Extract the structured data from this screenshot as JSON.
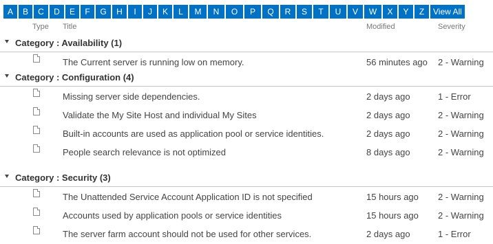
{
  "alphabet": [
    "A",
    "B",
    "C",
    "D",
    "E",
    "F",
    "G",
    "H",
    "I",
    "J",
    "K",
    "L",
    "M",
    "N",
    "O",
    "P",
    "Q",
    "R",
    "S",
    "T",
    "U",
    "V",
    "W",
    "X",
    "Y",
    "Z"
  ],
  "view_all_label": "View All",
  "columns": {
    "type": "Type",
    "title": "Title",
    "modified": "Modified",
    "severity": "Severity"
  },
  "groups": [
    {
      "label": "Category : Availability (1)",
      "items": [
        {
          "icon": "document-icon",
          "title": "The Current server is running low on memory.",
          "modified": "56 minutes ago",
          "severity": "2 - Warning"
        }
      ]
    },
    {
      "label": "Category : Configuration (4)",
      "items": [
        {
          "icon": "document-icon",
          "title": "Missing server side dependencies.",
          "modified": "2 days ago",
          "severity": "1 - Error"
        },
        {
          "icon": "document-icon",
          "title": "Validate the My Site Host and individual My Sites",
          "modified": "2 days ago",
          "severity": "2 - Warning"
        },
        {
          "icon": "document-icon",
          "title": "Built-in accounts are used as application pool or service identities.",
          "modified": "2 days ago",
          "severity": "2 - Warning"
        },
        {
          "icon": "document-icon",
          "title": "People search relevance is not optimized",
          "modified": "8 days ago",
          "severity": "2 - Warning"
        }
      ]
    },
    {
      "label": "Category : Security (3)",
      "items": [
        {
          "icon": "document-icon",
          "title": "The Unattended Service Account Application ID is not specified",
          "modified": "15 hours ago",
          "severity": "2 - Warning"
        },
        {
          "icon": "document-icon",
          "title": "Accounts used by application pools or service identities",
          "modified": "15 hours ago",
          "severity": "2 - Warning"
        },
        {
          "icon": "document-icon",
          "title": "The server farm account should not be used for other services.",
          "modified": "2 days ago",
          "severity": "1 - Error"
        }
      ]
    }
  ],
  "colors": {
    "accent": "#0072c6",
    "text": "#444444",
    "muted": "#777777",
    "divider": "#c6c6c6"
  }
}
